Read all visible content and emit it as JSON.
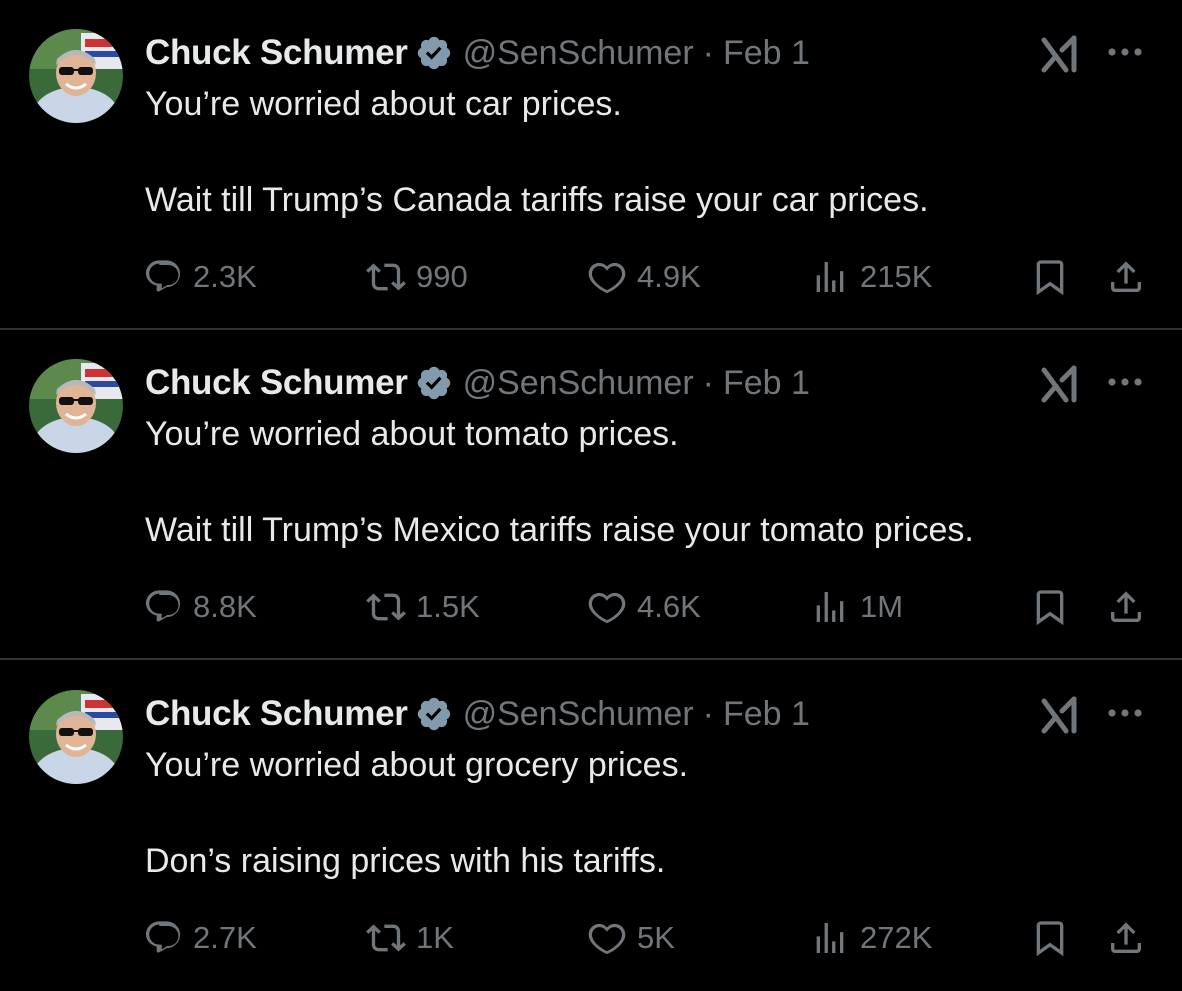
{
  "colors": {
    "background": "#000000",
    "text_primary": "#e7e9ea",
    "text_secondary": "#71767b",
    "verified_badge": "#829aab",
    "divider": "#2f3336"
  },
  "tweets": [
    {
      "author_name": "Chuck Schumer",
      "handle": "@SenSchumer",
      "separator": "·",
      "date": "Feb 1",
      "lines": [
        "You’re worried about car prices.",
        "Wait till Trump’s Canada tariffs raise your car prices."
      ],
      "replies": "2.3K",
      "reposts": "990",
      "likes": "4.9K",
      "views": "215K"
    },
    {
      "author_name": "Chuck Schumer",
      "handle": "@SenSchumer",
      "separator": "·",
      "date": "Feb 1",
      "lines": [
        "You’re worried about tomato prices.",
        "Wait till Trump’s Mexico tariffs raise your tomato prices."
      ],
      "replies": "8.8K",
      "reposts": "1.5K",
      "likes": "4.6K",
      "views": "1M"
    },
    {
      "author_name": "Chuck Schumer",
      "handle": "@SenSchumer",
      "separator": "·",
      "date": "Feb 1",
      "lines": [
        "You’re worried about grocery prices.",
        "Don’s raising prices with his tariffs."
      ],
      "replies": "2.7K",
      "reposts": "1K",
      "likes": "5K",
      "views": "272K"
    }
  ],
  "icons": {
    "verified": "verified-badge-icon",
    "grok": "grok-icon",
    "more": "more-options-icon",
    "reply": "reply-icon",
    "repost": "repost-icon",
    "like": "like-icon",
    "views": "views-icon",
    "bookmark": "bookmark-icon",
    "share": "share-icon"
  }
}
